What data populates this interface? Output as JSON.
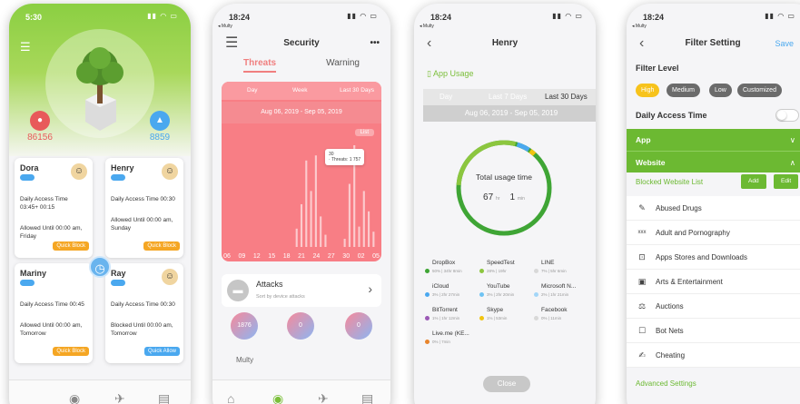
{
  "screen1": {
    "time": "5:30",
    "stat_left": "86156",
    "stat_right": "8859",
    "cards": [
      {
        "name": "Dora",
        "line1": "Daily Access Time 03:45+ 00:15",
        "line2": "Allowed Until 00:00 am, Friday",
        "button": "Quick Block"
      },
      {
        "name": "Henry",
        "line1": "Daily Access Time 00:30",
        "line2": "Allowed Until 00:00 am, Sunday",
        "button": "Quick Block"
      },
      {
        "name": "Mariny",
        "line1": "Daily Access Time 00:45",
        "line2": "Allowed Until 00:00 am, Tomorrow",
        "button": "Quick Block"
      },
      {
        "name": "Ray",
        "line1": "Daily Access Time 00:30",
        "line2": "Blocked Until 00:00 am, Tomorrow",
        "button": "Quick Allow"
      }
    ]
  },
  "screen2": {
    "time": "18:24",
    "multy": "◂ Multy",
    "title": "Security",
    "more": "•••",
    "tab_threats": "Threats",
    "tab_warning": "Warning",
    "seg_day": "Day",
    "seg_week": "Week",
    "seg_30": "Last 30 Days",
    "date_range": "Aug 06, 2019 - Sep 05, 2019",
    "list": "List",
    "tooltip_day": "30",
    "tooltip_text": "· Threats: 1 757",
    "x_ticks": [
      "06",
      "09",
      "12",
      "15",
      "18",
      "21",
      "24",
      "27",
      "30",
      "02",
      "05"
    ],
    "bar_values": [
      0,
      0,
      0,
      0,
      0,
      0,
      0,
      0,
      0,
      0,
      0,
      0,
      0,
      0,
      0.18,
      0.42,
      0.85,
      0.55,
      0.9,
      0.3,
      0.12,
      0,
      0,
      0,
      0.08,
      0.62,
      1.0,
      0.2,
      0.55,
      0.35,
      0.15
    ],
    "attacks_title": "Attacks",
    "attacks_sub": "Sort by device attacks",
    "bubbles": [
      "1876",
      "0",
      "0"
    ],
    "group": "Multy"
  },
  "screen3": {
    "time": "18:24",
    "multy": "◂ Multy",
    "title": "Henry",
    "app_usage": "App Usage",
    "seg_day": "Day",
    "seg_7": "Last 7 Days",
    "seg_30": "Last 30 Days",
    "date_range": "Aug 06, 2019 - Sep 05, 2019",
    "total_label": "Total usage time",
    "hours": "67",
    "hr": "hr",
    "minutes": "1",
    "min": "min",
    "apps": [
      {
        "name": "DropBox",
        "sub": "50% | 34hr 8min",
        "color": "#3fa535"
      },
      {
        "name": "SpeedTest",
        "sub": "28% | 19hr",
        "color": "#8cc63f"
      },
      {
        "name": "LINE",
        "sub": "7% | 5hr 6min",
        "color": "#d8d8d8"
      },
      {
        "name": "iCloud",
        "sub": "3% | 2hr 27min",
        "color": "#4aa8ef"
      },
      {
        "name": "YouTube",
        "sub": "3% | 2hr 20min",
        "color": "#6fc3f3"
      },
      {
        "name": "Microsoft N...",
        "sub": "2% | 1hr 21min",
        "color": "#a3d6f8"
      },
      {
        "name": "BitTorrent",
        "sub": "1% | 1hr 12min",
        "color": "#9b59b6"
      },
      {
        "name": "Skype",
        "sub": "1% | 53min",
        "color": "#f1c40f"
      },
      {
        "name": "Facebook",
        "sub": "0% | 11min",
        "color": "#d8d8d8"
      },
      {
        "name": "Live.me (KE...",
        "sub": "0% | 7min",
        "color": "#e8842c"
      }
    ],
    "close": "Close"
  },
  "screen4": {
    "time": "18:24",
    "multy": "◂ Multy",
    "title": "Filter Setting",
    "save": "Save",
    "filter_level": "Filter Level",
    "chips": [
      "High",
      "Medium",
      "Low",
      "Customized"
    ],
    "daily_access": "Daily Access Time",
    "app_bar": "App",
    "website_bar": "Website",
    "blocked_list": "Blocked Website List",
    "add": "Add",
    "edit": "Edit",
    "categories": [
      {
        "label": "Abused Drugs",
        "icon": "✎"
      },
      {
        "label": "Adult and Pornography",
        "icon": "xxx"
      },
      {
        "label": "Apps Stores and Downloads",
        "icon": "⊡"
      },
      {
        "label": "Arts & Entertainment",
        "icon": "▣"
      },
      {
        "label": "Auctions",
        "icon": "⚖"
      },
      {
        "label": "Bot Nets",
        "icon": "☐"
      },
      {
        "label": "Cheating",
        "icon": "✍"
      }
    ],
    "advanced": "Advanced Settings"
  }
}
